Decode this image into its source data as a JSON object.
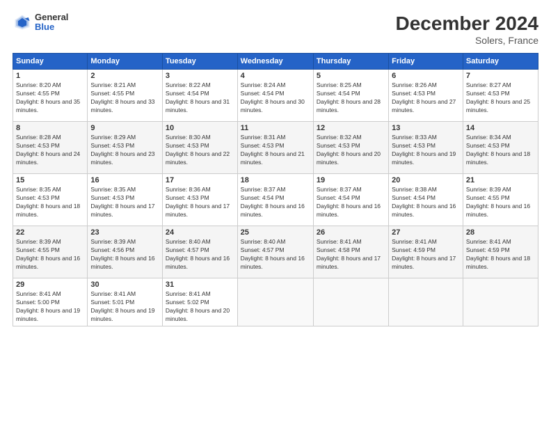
{
  "logo": {
    "general": "General",
    "blue": "Blue"
  },
  "header": {
    "month": "December 2024",
    "location": "Solers, France"
  },
  "days_of_week": [
    "Sunday",
    "Monday",
    "Tuesday",
    "Wednesday",
    "Thursday",
    "Friday",
    "Saturday"
  ],
  "weeks": [
    [
      {
        "day": "1",
        "sunrise": "8:20 AM",
        "sunset": "4:55 PM",
        "daylight": "8 hours and 35 minutes."
      },
      {
        "day": "2",
        "sunrise": "8:21 AM",
        "sunset": "4:55 PM",
        "daylight": "8 hours and 33 minutes."
      },
      {
        "day": "3",
        "sunrise": "8:22 AM",
        "sunset": "4:54 PM",
        "daylight": "8 hours and 31 minutes."
      },
      {
        "day": "4",
        "sunrise": "8:24 AM",
        "sunset": "4:54 PM",
        "daylight": "8 hours and 30 minutes."
      },
      {
        "day": "5",
        "sunrise": "8:25 AM",
        "sunset": "4:54 PM",
        "daylight": "8 hours and 28 minutes."
      },
      {
        "day": "6",
        "sunrise": "8:26 AM",
        "sunset": "4:53 PM",
        "daylight": "8 hours and 27 minutes."
      },
      {
        "day": "7",
        "sunrise": "8:27 AM",
        "sunset": "4:53 PM",
        "daylight": "8 hours and 25 minutes."
      }
    ],
    [
      {
        "day": "8",
        "sunrise": "8:28 AM",
        "sunset": "4:53 PM",
        "daylight": "8 hours and 24 minutes."
      },
      {
        "day": "9",
        "sunrise": "8:29 AM",
        "sunset": "4:53 PM",
        "daylight": "8 hours and 23 minutes."
      },
      {
        "day": "10",
        "sunrise": "8:30 AM",
        "sunset": "4:53 PM",
        "daylight": "8 hours and 22 minutes."
      },
      {
        "day": "11",
        "sunrise": "8:31 AM",
        "sunset": "4:53 PM",
        "daylight": "8 hours and 21 minutes."
      },
      {
        "day": "12",
        "sunrise": "8:32 AM",
        "sunset": "4:53 PM",
        "daylight": "8 hours and 20 minutes."
      },
      {
        "day": "13",
        "sunrise": "8:33 AM",
        "sunset": "4:53 PM",
        "daylight": "8 hours and 19 minutes."
      },
      {
        "day": "14",
        "sunrise": "8:34 AM",
        "sunset": "4:53 PM",
        "daylight": "8 hours and 18 minutes."
      }
    ],
    [
      {
        "day": "15",
        "sunrise": "8:35 AM",
        "sunset": "4:53 PM",
        "daylight": "8 hours and 18 minutes."
      },
      {
        "day": "16",
        "sunrise": "8:35 AM",
        "sunset": "4:53 PM",
        "daylight": "8 hours and 17 minutes."
      },
      {
        "day": "17",
        "sunrise": "8:36 AM",
        "sunset": "4:53 PM",
        "daylight": "8 hours and 17 minutes."
      },
      {
        "day": "18",
        "sunrise": "8:37 AM",
        "sunset": "4:54 PM",
        "daylight": "8 hours and 16 minutes."
      },
      {
        "day": "19",
        "sunrise": "8:37 AM",
        "sunset": "4:54 PM",
        "daylight": "8 hours and 16 minutes."
      },
      {
        "day": "20",
        "sunrise": "8:38 AM",
        "sunset": "4:54 PM",
        "daylight": "8 hours and 16 minutes."
      },
      {
        "day": "21",
        "sunrise": "8:39 AM",
        "sunset": "4:55 PM",
        "daylight": "8 hours and 16 minutes."
      }
    ],
    [
      {
        "day": "22",
        "sunrise": "8:39 AM",
        "sunset": "4:55 PM",
        "daylight": "8 hours and 16 minutes."
      },
      {
        "day": "23",
        "sunrise": "8:39 AM",
        "sunset": "4:56 PM",
        "daylight": "8 hours and 16 minutes."
      },
      {
        "day": "24",
        "sunrise": "8:40 AM",
        "sunset": "4:57 PM",
        "daylight": "8 hours and 16 minutes."
      },
      {
        "day": "25",
        "sunrise": "8:40 AM",
        "sunset": "4:57 PM",
        "daylight": "8 hours and 16 minutes."
      },
      {
        "day": "26",
        "sunrise": "8:41 AM",
        "sunset": "4:58 PM",
        "daylight": "8 hours and 17 minutes."
      },
      {
        "day": "27",
        "sunrise": "8:41 AM",
        "sunset": "4:59 PM",
        "daylight": "8 hours and 17 minutes."
      },
      {
        "day": "28",
        "sunrise": "8:41 AM",
        "sunset": "4:59 PM",
        "daylight": "8 hours and 18 minutes."
      }
    ],
    [
      {
        "day": "29",
        "sunrise": "8:41 AM",
        "sunset": "5:00 PM",
        "daylight": "8 hours and 19 minutes."
      },
      {
        "day": "30",
        "sunrise": "8:41 AM",
        "sunset": "5:01 PM",
        "daylight": "8 hours and 19 minutes."
      },
      {
        "day": "31",
        "sunrise": "8:41 AM",
        "sunset": "5:02 PM",
        "daylight": "8 hours and 20 minutes."
      },
      null,
      null,
      null,
      null
    ]
  ]
}
